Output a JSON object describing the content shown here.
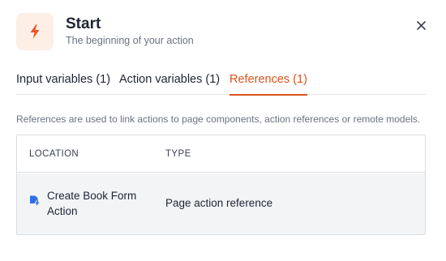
{
  "header": {
    "title": "Start",
    "subtitle": "The beginning of your action",
    "icon": "lightning-bolt-icon",
    "close_icon": "close-icon"
  },
  "tabs": [
    {
      "label": "Input variables (1)",
      "active": false
    },
    {
      "label": "Action variables (1)",
      "active": false
    },
    {
      "label": "References (1)",
      "active": true
    }
  ],
  "description": "References are used to link actions to page components, action references or remote models.",
  "table": {
    "columns": [
      "LOCATION",
      "TYPE"
    ],
    "rows": [
      {
        "location": "Create Book Form Action",
        "type": "Page action reference",
        "icon": "page-action-icon"
      }
    ]
  },
  "colors": {
    "accent": "#d9541f",
    "icon_bg": "#fdeee6",
    "reference_icon": "#2f6fe4"
  }
}
